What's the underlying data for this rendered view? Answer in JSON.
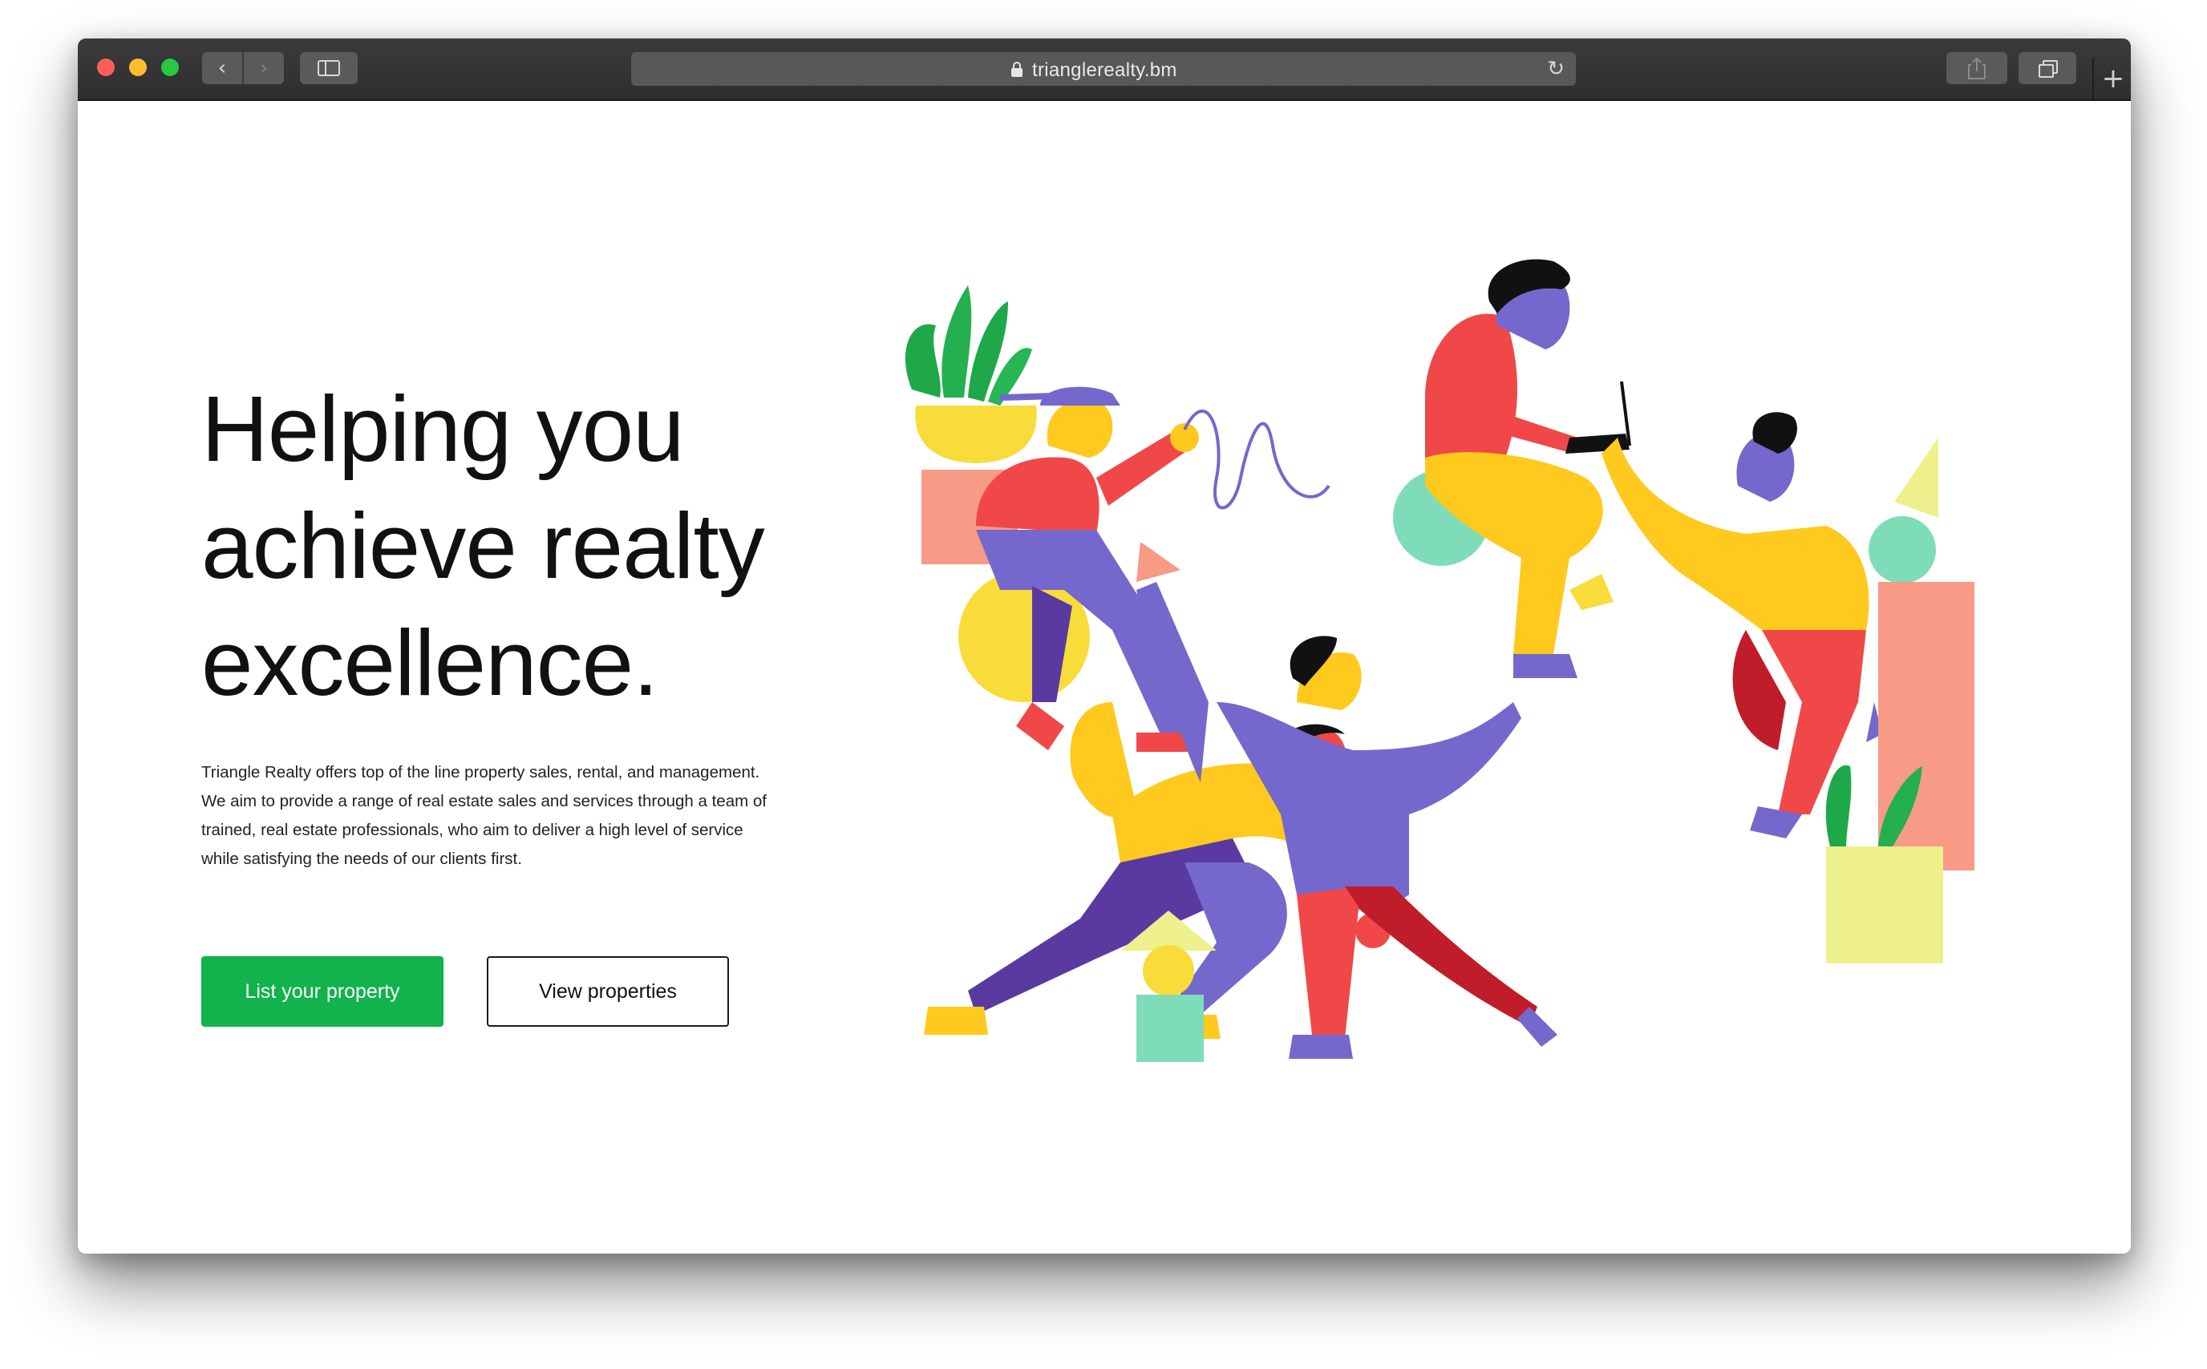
{
  "browser": {
    "url": "trianglerealty.bm",
    "icons": [
      "close-dot",
      "minimize-dot",
      "zoom-dot",
      "chevron-left-icon",
      "chevron-right-icon",
      "sidebar-icon",
      "lock-icon",
      "reload-icon",
      "share-icon",
      "tabs-icon",
      "plus-icon"
    ],
    "glyphs": {
      "back": "‹",
      "forward": "›",
      "reload": "↻",
      "new_tab": "+"
    }
  },
  "hero": {
    "title_line1": "Helping you",
    "title_line2": "achieve realty",
    "title_line3": "excellence.",
    "description_line1": "Triangle Realty offers top of the line property sales, rental, and management.",
    "description_line2": "We aim to provide a range of real estate sales and services through a team of",
    "description_line3": "trained, real estate professionals, who aim to deliver a high level of service",
    "description_line4": "while satisfying the needs of our clients first.",
    "primary_cta": "List your property",
    "secondary_cta": "View properties"
  },
  "colors": {
    "primary_green": "#12b24c",
    "illustration_red": "#f04848",
    "illustration_yellow": "#ffc91e",
    "illustration_purple": "#7468cc",
    "illustration_mint": "#7fdcb8",
    "illustration_salmon": "#f79a86",
    "illustration_pale_yellow": "#eef08c",
    "illustration_plant_green": "#1fa84a"
  }
}
